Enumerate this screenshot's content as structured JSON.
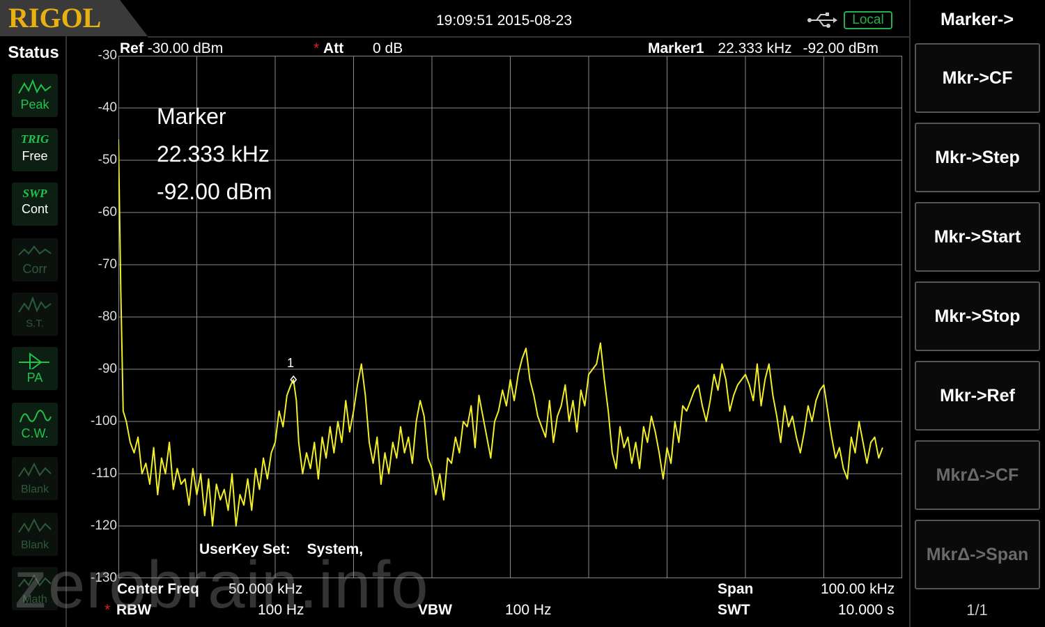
{
  "header": {
    "logo": "RIGOL",
    "datetime": "19:09:51 2015-08-23",
    "usb_icon": "usb-icon",
    "local_label": "Local"
  },
  "status": {
    "title": "Status",
    "items": [
      {
        "icon": "peak-icon",
        "label": "Peak",
        "active": true
      },
      {
        "top": "TRIG",
        "label": "Free",
        "active": true
      },
      {
        "top": "SWP",
        "label": "Cont",
        "active": true
      },
      {
        "icon": "corr-icon",
        "label": "Corr",
        "active": false
      },
      {
        "icon": "st-icon",
        "label": "S.T.",
        "active": false
      },
      {
        "icon": "pa-icon",
        "label": "PA",
        "active": true
      },
      {
        "icon": "cw-icon",
        "label": "C.W.",
        "active": true
      },
      {
        "icon": "blank-icon",
        "label": "Blank",
        "active": false
      },
      {
        "icon": "blank-icon",
        "label": "Blank",
        "active": false
      },
      {
        "icon": "math-icon",
        "label": "Math",
        "active": false
      }
    ]
  },
  "display": {
    "ref_label": "Ref",
    "ref_value": "-30.00 dBm",
    "att_label": "Att",
    "att_value": "0 dB",
    "marker_label": "Marker1",
    "marker_freq": "22.333 kHz",
    "marker_amp": "-92.00 dBm",
    "marker_box_title": "Marker",
    "marker_box_freq": "22.333 kHz",
    "marker_box_amp": "-92.00 dBm",
    "marker_number": "1",
    "userkey_label": "UserKey Set:",
    "userkey_value": "System,",
    "y_ticks": [
      "-30",
      "-40",
      "-50",
      "-60",
      "-70",
      "-80",
      "-90",
      "-100",
      "-110",
      "-120",
      "-130"
    ],
    "trace_color": "#f2ee2a",
    "grid_color": "#8a8a8a"
  },
  "bottom": {
    "center_freq_label": "Center Freq",
    "center_freq_value": "50.000 kHz",
    "span_label": "Span",
    "span_value": "100.00 kHz",
    "rbw_label": "RBW",
    "rbw_value": "100 Hz",
    "vbw_label": "VBW",
    "vbw_value": "100 Hz",
    "swt_label": "SWT",
    "swt_value": "10.000 s"
  },
  "menu": {
    "title": "Marker->",
    "buttons": [
      {
        "label": "Mkr->CF",
        "enabled": true
      },
      {
        "label": "Mkr->Step",
        "enabled": true
      },
      {
        "label": "Mkr->Start",
        "enabled": true
      },
      {
        "label": "Mkr->Stop",
        "enabled": true
      },
      {
        "label": "Mkr->Ref",
        "enabled": true
      },
      {
        "label": "MkrΔ->CF",
        "enabled": false
      },
      {
        "label": "MkrΔ->Span",
        "enabled": false
      }
    ],
    "page": "1/1"
  },
  "watermark": "zerobrain.info",
  "chart_data": {
    "type": "line",
    "x_unit": "kHz",
    "y_unit": "dBm",
    "xlim": [
      0,
      100
    ],
    "ylim": [
      -130,
      -30
    ],
    "grid": true,
    "x": [
      0,
      0.3,
      0.6,
      1,
      1.5,
      2,
      2.5,
      3,
      3.5,
      4,
      4.5,
      5,
      5.5,
      6,
      6.5,
      7,
      7.5,
      8,
      8.5,
      9,
      9.5,
      10,
      10.5,
      11,
      11.5,
      12,
      12.5,
      13,
      13.5,
      14,
      14.5,
      15,
      15.5,
      16,
      16.5,
      17,
      17.5,
      18,
      18.5,
      19,
      19.5,
      20,
      20.5,
      21,
      21.5,
      22,
      22.333,
      22.7,
      23,
      23.5,
      24,
      24.5,
      25,
      25.5,
      26,
      26.5,
      27,
      27.5,
      28,
      28.5,
      29,
      29.5,
      30,
      30.5,
      31,
      31.5,
      32,
      32.5,
      33,
      33.5,
      34,
      34.5,
      35,
      35.5,
      36,
      36.5,
      37,
      37.5,
      38,
      38.5,
      39,
      39.5,
      40,
      40.5,
      41,
      41.5,
      42,
      42.5,
      43,
      43.5,
      44,
      44.5,
      45,
      45.5,
      46,
      46.5,
      47,
      47.5,
      48,
      48.5,
      49,
      49.5,
      50,
      50.5,
      51,
      51.5,
      52,
      52.5,
      53,
      53.5,
      54,
      54.5,
      55,
      55.5,
      56,
      56.5,
      57,
      57.5,
      58,
      58.5,
      59,
      59.5,
      60,
      60.5,
      61,
      61.5,
      62,
      62.5,
      63,
      63.5,
      64,
      64.5,
      65,
      65.5,
      66,
      66.5,
      67,
      67.5,
      68,
      68.5,
      69,
      69.5,
      70,
      70.5,
      71,
      71.5,
      72,
      72.5,
      73,
      73.5,
      74,
      74.5,
      75,
      75.5,
      76,
      76.5,
      77,
      77.5,
      78,
      78.5,
      79,
      79.5,
      80,
      80.5,
      81,
      81.5,
      82,
      82.5,
      83,
      83.5,
      84,
      84.5,
      85,
      85.5,
      86,
      86.5,
      87,
      87.5,
      88,
      88.5,
      89,
      89.5,
      90,
      90.5,
      91,
      91.5,
      92,
      92.5,
      93,
      93.5,
      94,
      94.5,
      95,
      95.5,
      96,
      96.5,
      97,
      97.5,
      98,
      98.5,
      99,
      99.5,
      100
    ],
    "y": [
      -46,
      -75,
      -98,
      -100,
      -104,
      -106,
      -103,
      -110,
      -108,
      -112,
      -105,
      -114,
      -107,
      -110,
      -104,
      -113,
      -109,
      -112,
      -111,
      -116,
      -109,
      -114,
      -110,
      -118,
      -111,
      -120,
      -112,
      -115,
      -113,
      -117,
      -110,
      -120,
      -114,
      -116,
      -111,
      -117,
      -109,
      -113,
      -107,
      -111,
      -106,
      -104,
      -98,
      -101,
      -95,
      -93,
      -92,
      -96,
      -104,
      -110,
      -106,
      -109,
      -104,
      -111,
      -103,
      -107,
      -101,
      -106,
      -100,
      -104,
      -96,
      -102,
      -98,
      -93,
      -89,
      -95,
      -104,
      -108,
      -103,
      -112,
      -106,
      -110,
      -104,
      -107,
      -101,
      -106,
      -103,
      -108,
      -100,
      -96,
      -99,
      -107,
      -109,
      -114,
      -110,
      -115,
      -107,
      -108,
      -103,
      -106,
      -100,
      -101,
      -97,
      -105,
      -95,
      -99,
      -103,
      -107,
      -100,
      -98,
      -94,
      -97,
      -92,
      -96,
      -91,
      -88,
      -86,
      -92,
      -95,
      -99,
      -101,
      -103,
      -96,
      -104,
      -99,
      -97,
      -93,
      -100,
      -96,
      -102,
      -94,
      -97,
      -91,
      -90,
      -89,
      -85,
      -92,
      -98,
      -106,
      -109,
      -101,
      -105,
      -103,
      -108,
      -104,
      -109,
      -101,
      -104,
      -99,
      -102,
      -106,
      -111,
      -105,
      -108,
      -100,
      -104,
      -97,
      -98,
      -96,
      -94,
      -93,
      -97,
      -100,
      -96,
      -91,
      -94,
      -89,
      -92,
      -98,
      -95,
      -93,
      -92,
      -91,
      -93,
      -96,
      -89,
      -97,
      -92,
      -89,
      -95,
      -99,
      -104,
      -97,
      -101,
      -99,
      -103,
      -106,
      -102,
      -97,
      -100,
      -96,
      -94,
      -93,
      -98,
      -103,
      -107,
      -105,
      -109,
      -111,
      -103,
      -106,
      -100,
      -104,
      -108,
      -104,
      -103,
      -107,
      -105
    ]
  }
}
